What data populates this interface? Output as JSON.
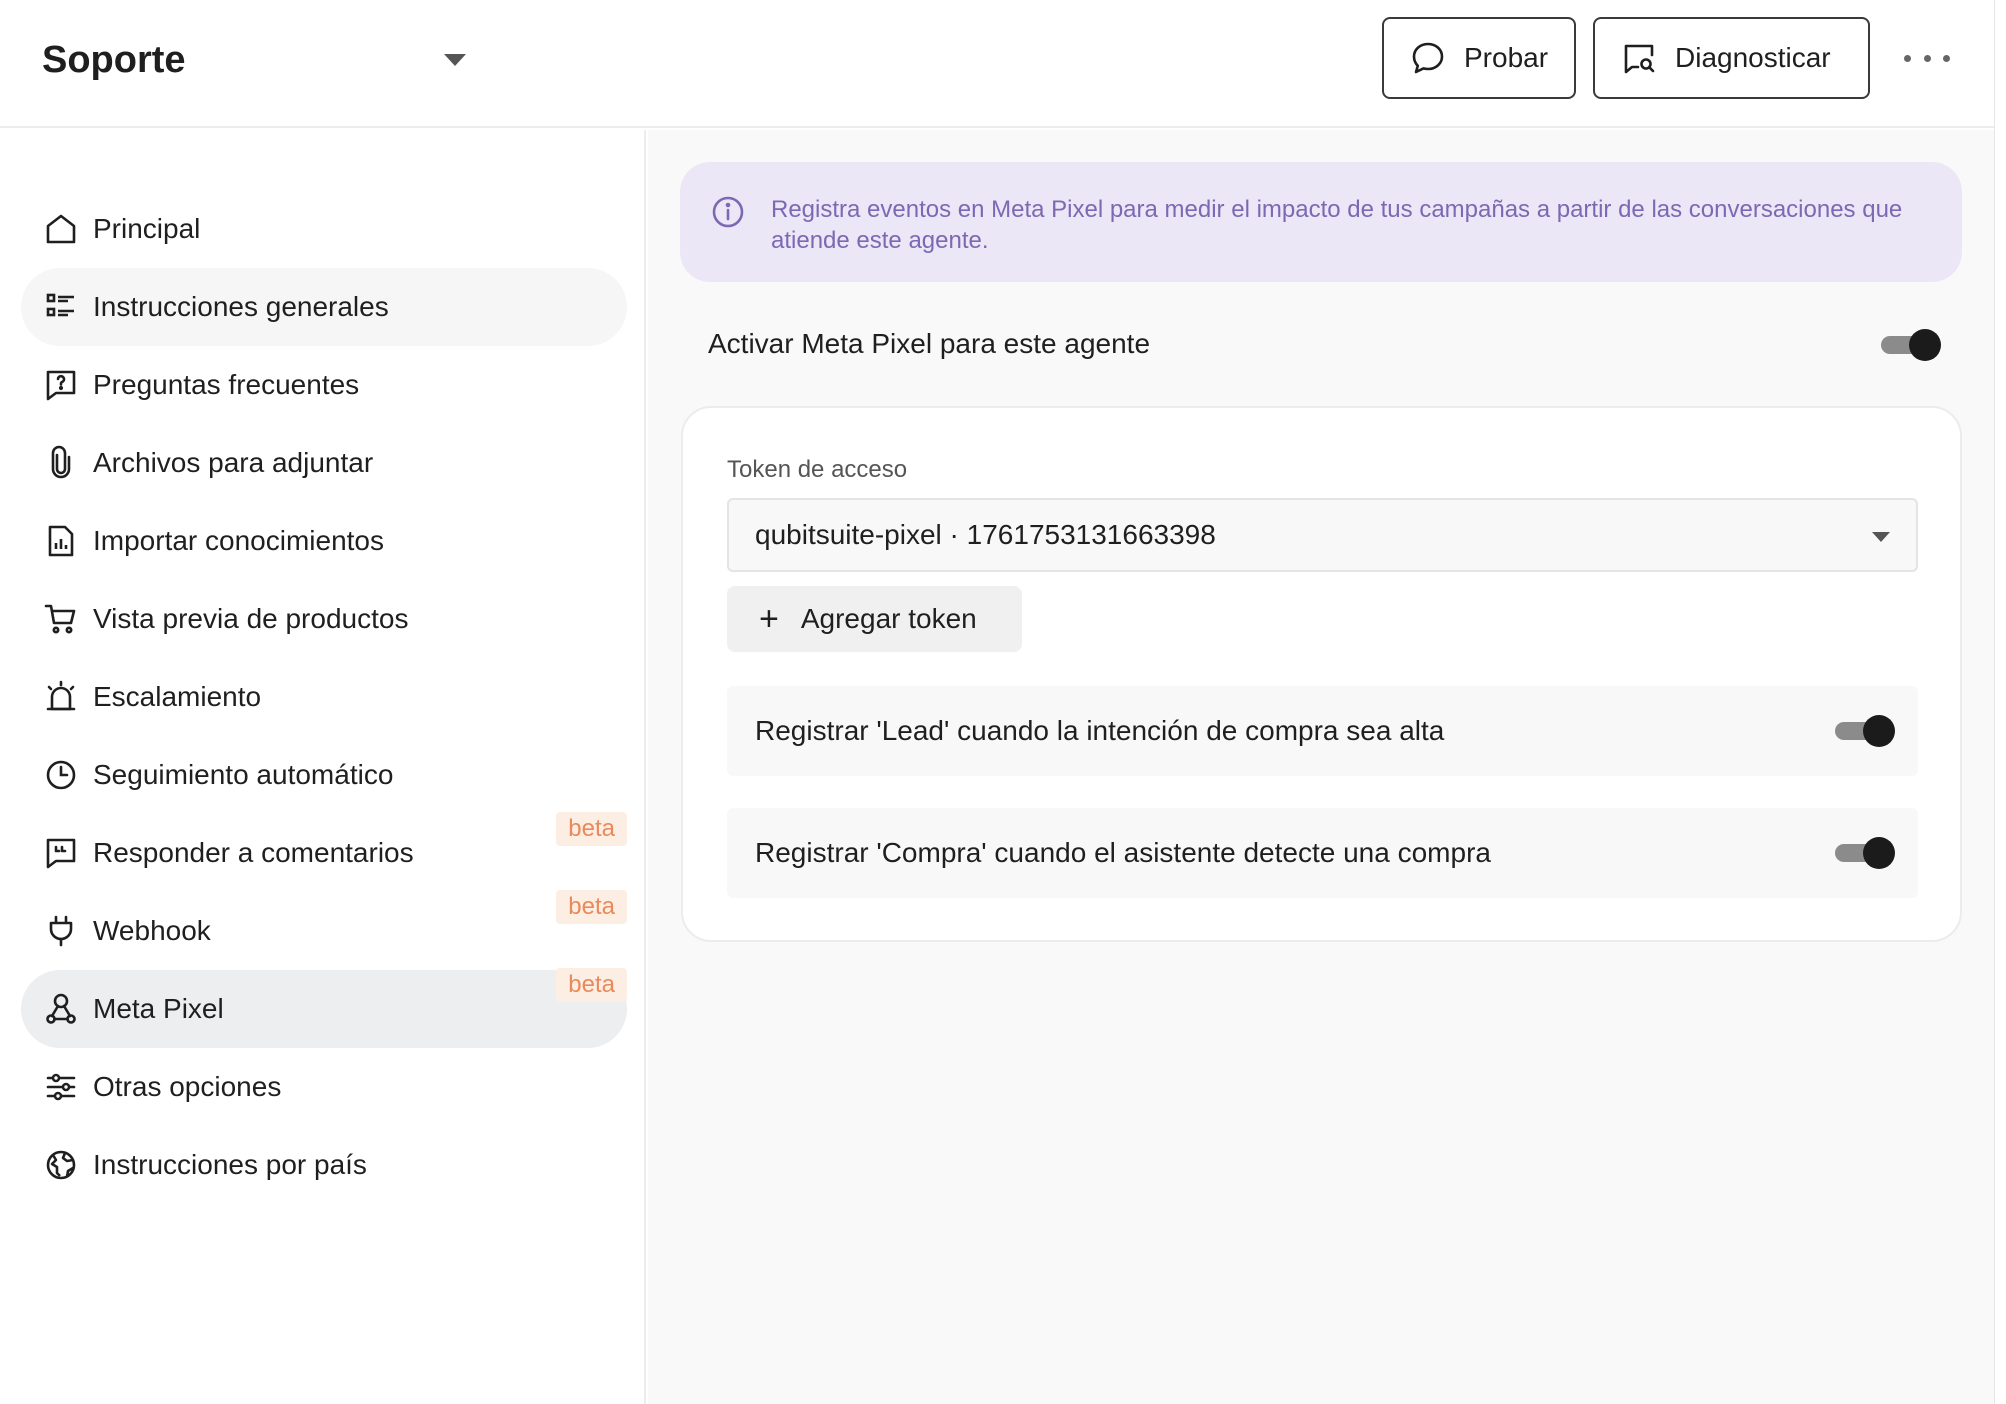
{
  "header": {
    "agent_name": "Soporte",
    "test_label": "Probar",
    "diagnose_label": "Diagnosticar"
  },
  "sidebar": {
    "items": [
      {
        "label": "Principal",
        "icon": "home-icon"
      },
      {
        "label": "Instrucciones generales",
        "icon": "list-icon"
      },
      {
        "label": "Preguntas frecuentes",
        "icon": "question-icon"
      },
      {
        "label": "Archivos para adjuntar",
        "icon": "paperclip-icon"
      },
      {
        "label": "Importar conocimientos",
        "icon": "report-icon"
      },
      {
        "label": "Vista previa de productos",
        "icon": "cart-icon"
      },
      {
        "label": "Escalamiento",
        "icon": "alarm-icon"
      },
      {
        "label": "Seguimiento automático",
        "icon": "clock-icon"
      },
      {
        "label": "Responder a comentarios",
        "icon": "comment-quote-icon",
        "badge": "beta"
      },
      {
        "label": "Webhook",
        "icon": "plug-icon",
        "badge": "beta"
      },
      {
        "label": "Meta Pixel",
        "icon": "webhook-nodes-icon",
        "badge": "beta"
      },
      {
        "label": "Otras opciones",
        "icon": "sliders-icon"
      },
      {
        "label": "Instrucciones por país",
        "icon": "globe-icon"
      }
    ],
    "active_item": "Meta Pixel"
  },
  "main": {
    "info_text": "Registra eventos en Meta Pixel para medir el impacto de tus campañas a partir de las conversaciones que atiende este agente.",
    "enable_label": "Activar Meta Pixel para este agente",
    "enable_on": true,
    "token_label": "Token de acceso",
    "token_value": "qubitsuite-pixel · 1761753131663398",
    "add_token_label": "Agregar token",
    "events": [
      {
        "label": "Registrar 'Lead' cuando la intención de compra sea alta",
        "on": true
      },
      {
        "label": "Registrar 'Compra' cuando el asistente detecte una compra",
        "on": true
      }
    ]
  },
  "colors": {
    "info_bg": "#ebe7f6",
    "info_text": "#7d68b3",
    "beta_bg": "#fdeee3",
    "beta_text": "#ea8a5a",
    "active_bg": "#eceef0"
  }
}
